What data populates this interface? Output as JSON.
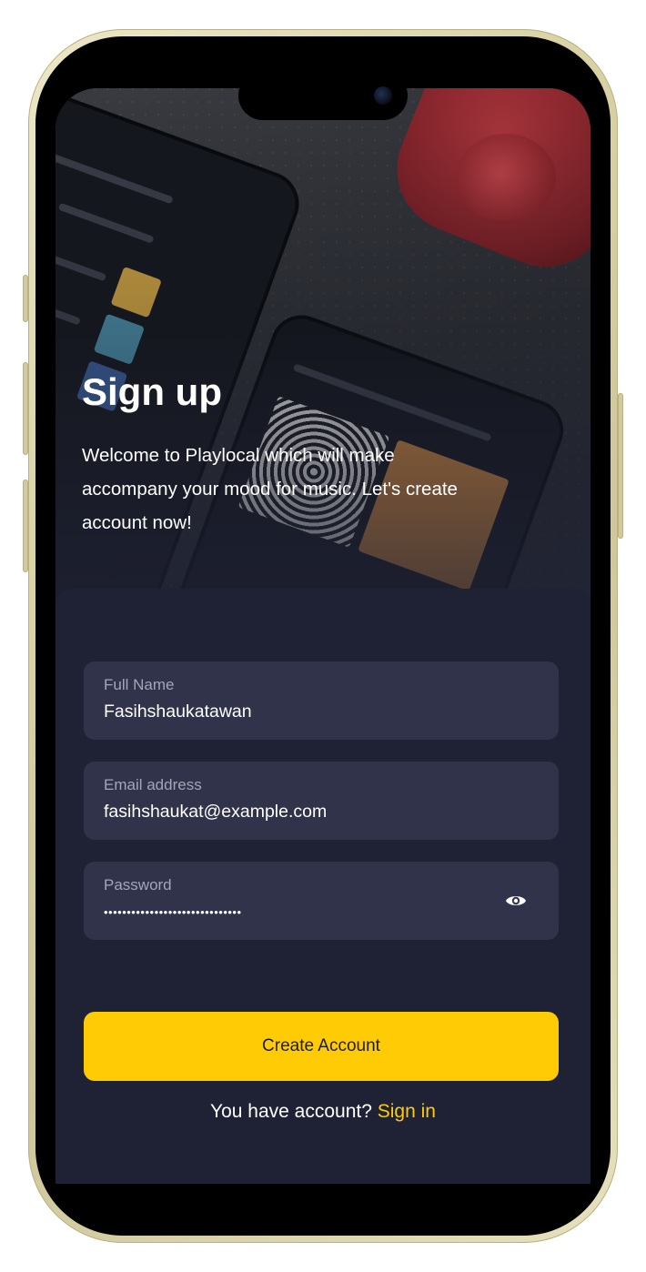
{
  "signup": {
    "title": "Sign up",
    "subtitle": "Welcome to Playlocal which will make accompany your mood for music. Let's create account now!"
  },
  "form": {
    "full_name": {
      "label": "Full Name",
      "value": "Fasihshaukatawan"
    },
    "email": {
      "label": "Email address",
      "value": "fasihshaukat@example.com"
    },
    "password": {
      "label": "Password",
      "value": "••••••••••••••••••••••••••••••"
    },
    "toggle_icon": "eye-icon"
  },
  "actions": {
    "create_label": "Create Account",
    "has_account_text": "You have account?",
    "signin_label": "Sign in"
  },
  "colors": {
    "accent": "#ffcb05",
    "panel": "#1f2235",
    "field": "#30334a"
  }
}
